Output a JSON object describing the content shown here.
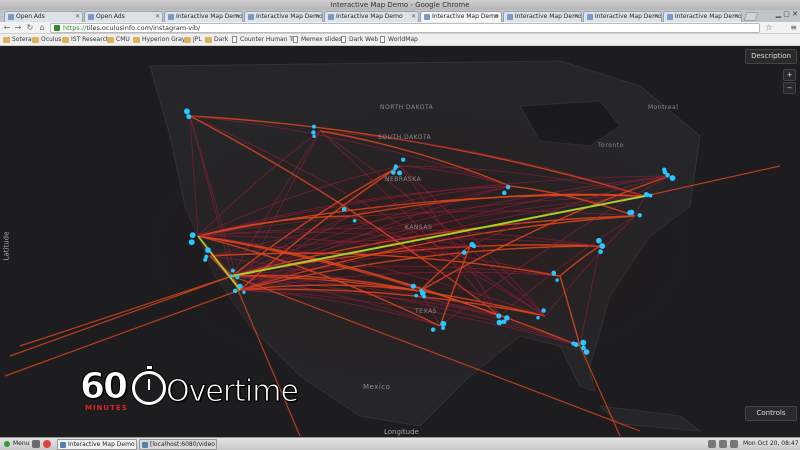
{
  "window": {
    "title": "Interactive Map Demo - Google Chrome"
  },
  "tabs": [
    {
      "label": "Open Ads",
      "active": false
    },
    {
      "label": "Open Ads",
      "active": false
    },
    {
      "label": "Interactive Map Demo",
      "active": false
    },
    {
      "label": "Interactive Map Demo",
      "active": false
    },
    {
      "label": "Interactive Map Demo",
      "active": false
    },
    {
      "label": "Interactive Map Demo",
      "active": true
    },
    {
      "label": "Interactive Map Demo",
      "active": false
    },
    {
      "label": "Interactive Map Demo",
      "active": false
    },
    {
      "label": "Interactive Map Demo",
      "active": false
    }
  ],
  "toolbar": {
    "url_scheme": "https://",
    "url_rest": "tiles.oculusinfo.com/instagram-vib/"
  },
  "bookmarks": [
    {
      "label": "Sotera",
      "kind": "folder"
    },
    {
      "label": "Oculus",
      "kind": "folder"
    },
    {
      "label": "IST Research",
      "kind": "folder"
    },
    {
      "label": "CMU",
      "kind": "folder"
    },
    {
      "label": "Hyperion Gray",
      "kind": "folder"
    },
    {
      "label": "JPL",
      "kind": "folder"
    },
    {
      "label": "Dark",
      "kind": "folder"
    },
    {
      "label": "Counter Human Tr",
      "kind": "page"
    },
    {
      "label": "Memex slides",
      "kind": "page"
    },
    {
      "label": "Dark Web",
      "kind": "page"
    },
    {
      "label": "WorldMap",
      "kind": "page"
    }
  ],
  "map": {
    "description_button": "Description",
    "controls_button": "Controls",
    "zoom_in": "+",
    "zoom_out": "−",
    "y_axis_label": "Latitude",
    "x_axis_label": "Longitude",
    "places": [
      "NORTH DAKOTA",
      "SOUTH DAKOTA",
      "NEBRASKA",
      "KANSAS",
      "TEXAS",
      "Mexico",
      "Montreal",
      "Toronto"
    ]
  },
  "logo": {
    "number": "60",
    "minutes": "MINUTES",
    "word": "Overtime"
  },
  "taskbar": {
    "menu": "Menu",
    "tasks": [
      {
        "label": "Interactive Map Demo",
        "active": true
      },
      {
        "label": "[localhost:6080/video",
        "active": false
      }
    ],
    "clock": "Mon Oct 20, 08:47"
  },
  "colors": {
    "map_background": "#1d1d1f",
    "flow_line": "#e0461c",
    "flow_line_dim": "#9a1f3a",
    "hot_line": "#a5d22b",
    "node": "#27c7ff"
  }
}
